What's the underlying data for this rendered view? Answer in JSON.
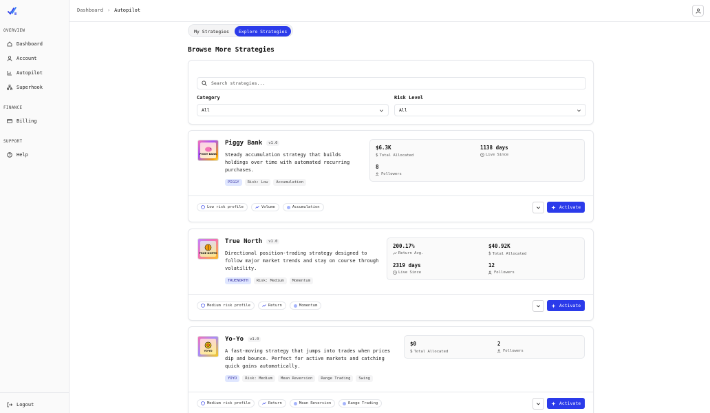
{
  "sidebar": {
    "sections": [
      {
        "label": "OVERVIEW",
        "items": [
          {
            "label": "Dashboard",
            "icon": "home-icon"
          },
          {
            "label": "Account",
            "icon": "user-icon"
          },
          {
            "label": "Autopilot",
            "icon": "bar-chart-icon"
          },
          {
            "label": "Superhook",
            "icon": "network-icon"
          }
        ]
      },
      {
        "label": "FINANCE",
        "items": [
          {
            "label": "Billing",
            "icon": "credit-card-icon"
          }
        ]
      },
      {
        "label": "SUPPORT",
        "items": [
          {
            "label": "Help",
            "icon": "help-circle-icon"
          }
        ]
      }
    ],
    "logout_label": "Logout"
  },
  "header": {
    "breadcrumb": [
      "Dashboard",
      "Autopilot"
    ]
  },
  "tabs": [
    "My Strategies",
    "Explore Strategies"
  ],
  "active_tab": "Explore Strategies",
  "page_title": "Browse More Strategies",
  "filters": {
    "search_placeholder": "Search strategies...",
    "category_label": "Category",
    "category_value": "All",
    "risk_label": "Risk Level",
    "risk_value": "All"
  },
  "strategies": [
    {
      "name": "Piggy Bank",
      "version": "v1.0",
      "thumb_text": "PIGGY BANK",
      "description": [
        "Steady accumulation strategy that builds",
        "holdings over time with automated recurring",
        "purchases."
      ],
      "code_tag": "PIGGY",
      "tags": [
        "Risk: Low",
        "Accumulation"
      ],
      "stats": [
        {
          "value": "$6.3K",
          "label": "Total Allocated",
          "icon": "dollar-icon"
        },
        {
          "value": "1138 days",
          "label": "Live Since",
          "icon": "clock-icon"
        },
        {
          "value": "8",
          "label": "Followers",
          "icon": "users-icon"
        }
      ],
      "chips": [
        "Low risk profile",
        "Volume",
        "Accumulation"
      ],
      "activate_label": "Activate"
    },
    {
      "name": "True North",
      "version": "v1.0",
      "thumb_text": "TRUE NORTH",
      "description": [
        "Directional position-trading strategy designed to",
        "follow major market trends and stay on course through",
        "volatility."
      ],
      "code_tag": "TRUENORTH",
      "tags": [
        "Risk: Medium",
        "Momentum"
      ],
      "stats": [
        {
          "value": "200.17%",
          "label": "Return Avg.",
          "icon": "trend-icon"
        },
        {
          "value": "$40.92K",
          "label": "Total Allocated",
          "icon": "dollar-icon"
        },
        {
          "value": "2319 days",
          "label": "Live Since",
          "icon": "clock-icon"
        },
        {
          "value": "12",
          "label": "Followers",
          "icon": "users-icon"
        }
      ],
      "chips": [
        "Medium risk profile",
        "Return",
        "Momentum"
      ],
      "activate_label": "Activate"
    },
    {
      "name": "Yo-Yo",
      "version": "v1.0",
      "thumb_text": "YO-YO",
      "description": [
        "A fast-moving strategy that jumps into trades when prices",
        "dip and bounce. Perfect for active markets and catching",
        "quick gains automatically."
      ],
      "code_tag": "YOYO",
      "tags": [
        "Risk: Medium",
        "Mean Reversion",
        "Range Trading",
        "Swing"
      ],
      "stats": [
        {
          "value": "$0",
          "label": "Total Allocated",
          "icon": "dollar-icon"
        },
        {
          "value": "2",
          "label": "Followers",
          "icon": "users-icon"
        }
      ],
      "chips": [
        "Medium risk profile",
        "Return",
        "Mean Reversion",
        "Range Trading"
      ],
      "activate_label": "Activate"
    }
  ],
  "colors": {
    "accent": "#2b3bea",
    "code_tag_bg": "#e0e7ff"
  }
}
